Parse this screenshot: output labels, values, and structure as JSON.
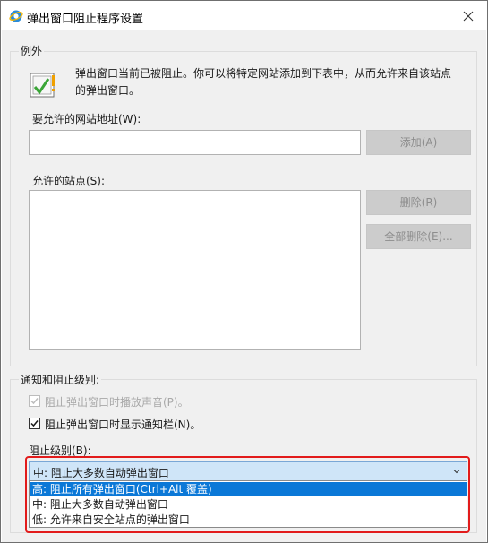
{
  "window": {
    "title": "弹出窗口阻止程序设置",
    "icon": "ie-globe-icon",
    "close_icon": "close-icon"
  },
  "exceptions": {
    "group_title": "例外",
    "info_text": "弹出窗口当前已被阻止。你可以将特定网站添加到下表中，从而允许来自该站点的弹出窗口。",
    "address_label": "要允许的网站地址(W):",
    "address_value": "",
    "add_button": "添加(A)",
    "allowed_sites_label": "允许的站点(S):",
    "allowed_sites": [],
    "remove_button": "删除(R)",
    "remove_all_button": "全部删除(E)..."
  },
  "notification": {
    "group_title": "通知和阻止级别:",
    "play_sound_label": "阻止弹出窗口时播放声音(P)。",
    "play_sound_checked": true,
    "play_sound_enabled": false,
    "show_bar_label": "阻止弹出窗口时显示通知栏(N)。",
    "show_bar_checked": true,
    "level_label": "阻止级别(B):",
    "level_selected": "中: 阻止大多数自动弹出窗口",
    "level_options": [
      "高: 阻止所有弹出窗口(Ctrl+Alt 覆盖)",
      "中: 阻止大多数自动弹出窗口",
      "低: 允许来自安全站点的弹出窗口"
    ],
    "highlighted_option_index": 0
  },
  "colors": {
    "dialog_bg": "#f0f0f0",
    "highlight": "#0b78d7",
    "annotation_red": "#e21b1b",
    "disabled_button": "#cccccc"
  }
}
